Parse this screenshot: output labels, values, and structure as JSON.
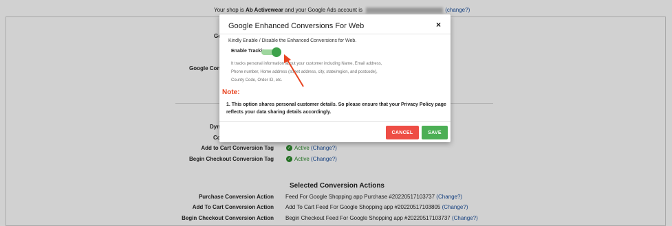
{
  "background": {
    "shop_line": {
      "prefix": "Your shop is ",
      "shop_name": "Ab Activewear",
      "middle": " and your Google Ads account is ",
      "change": "(change?)"
    },
    "left_labels": {
      "go_partial": "Go",
      "google_conv_partial": "Google Conv",
      "dyn_partial": "Dyn",
      "co_partial": "Co"
    },
    "tags": [
      {
        "label": "Add to Cart Conversion Tag",
        "status": "Active",
        "change": "(Change?)"
      },
      {
        "label": "Begin Checkout Conversion Tag",
        "status": "Active",
        "change": "(Change?)"
      }
    ],
    "section_title": "Selected Conversion Actions",
    "actions": [
      {
        "label": "Purchase Conversion Action",
        "value": "Feed For Google Shopping app Purchase #20220517103737",
        "change": "(Change?)"
      },
      {
        "label": "Add To Cart Conversion Action",
        "value": "Add To Cart Feed For Google Shopping app #20220517103805",
        "change": "(Change?)"
      },
      {
        "label": "Begin Checkout Conversion Action",
        "value": "Begin Checkout Feed For Google Shopping app #20220517103737",
        "change": "(Change?)"
      }
    ]
  },
  "modal": {
    "title": "Google Enhanced Conversions For Web",
    "close_icon": "×",
    "subtitle": "Kindly Enable / Disable the Enhanced Conversions for Web.",
    "toggle_label": "Enable Tracking",
    "toggle_on": true,
    "description": "It tracks personal information about your customer including Name, Email address, Phone number, Home address (street address, city, state/region, and postcode), County Code, Order ID, etc.",
    "note_title": "Note:",
    "note_items": [
      "1. This option shares personal customer details. So please ensure that your Privacy Policy page reflects your data sharing details accordingly."
    ],
    "cancel_label": "CANCEL",
    "save_label": "SAVE"
  },
  "colors": {
    "accent_green": "#3ea24b",
    "cancel_red": "#ee4d45",
    "note_orange": "#e8431f",
    "link_blue": "#1a4f9c"
  }
}
